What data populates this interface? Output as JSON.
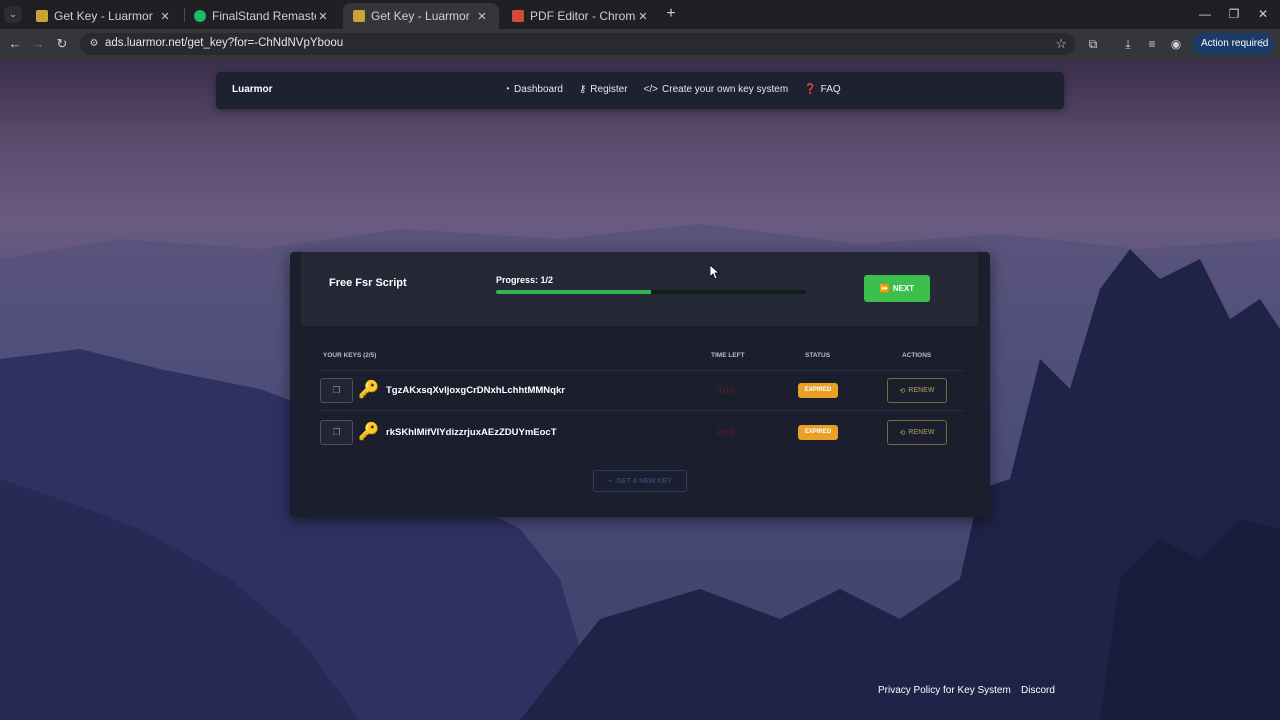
{
  "browser": {
    "tabs": [
      {
        "title": "Get Key - Luarmor",
        "active": false,
        "favicon_color": "#c9a33a"
      },
      {
        "title": "FinalStand Remastered: Script",
        "active": false,
        "favicon_color": "#1fb86a"
      },
      {
        "title": "Get Key - Luarmor",
        "active": true,
        "favicon_color": "#c9a33a"
      },
      {
        "title": "PDF Editor - Chrome Web Store",
        "active": false,
        "favicon_color": "#d24b3c"
      }
    ],
    "close_glyph": "✕",
    "url": "ads.luarmor.net/get_key?for=-ChNdNVpYboou",
    "action_required": "Action required",
    "menu_glyph": "⋮"
  },
  "site": {
    "brand": "Luarmor",
    "nav": [
      {
        "label": "Dashboard",
        "icon": "dashboard-icon"
      },
      {
        "label": "Register",
        "icon": "key-icon"
      },
      {
        "label": "Create your own key system",
        "icon": "code-icon"
      },
      {
        "label": "FAQ",
        "icon": "question-icon"
      }
    ]
  },
  "card": {
    "script_title": "Free Fsr Script",
    "progress_label": "Progress: 1/2",
    "progress_fraction": 0.5,
    "next_label": "NEXT",
    "headers": {
      "keys": "YOUR KEYS (2/5)",
      "time_left": "TIME LEFT",
      "status": "STATUS",
      "actions": "ACTIONS"
    },
    "keys": [
      {
        "key": "TgzAKxsqXvljoxgCrDNxhLchhtMMNqkr",
        "time_left": "0:0:0",
        "status": "EXPIRED",
        "action": "RENEW"
      },
      {
        "key": "rkSKhIMifVIYdizzrjuxAEzZDUYmEocT",
        "time_left": "0:0:0",
        "status": "EXPIRED",
        "action": "RENEW"
      }
    ],
    "get_new_key_label": "GET A NEW KEY"
  },
  "footer": {
    "privacy": "Privacy Policy for Key System",
    "discord": "Discord"
  },
  "colors": {
    "progress": "#35b34f",
    "next_button": "#3cbe4b",
    "expired_badge": "#e8a027",
    "action_required_bg": "#1a3a67"
  }
}
